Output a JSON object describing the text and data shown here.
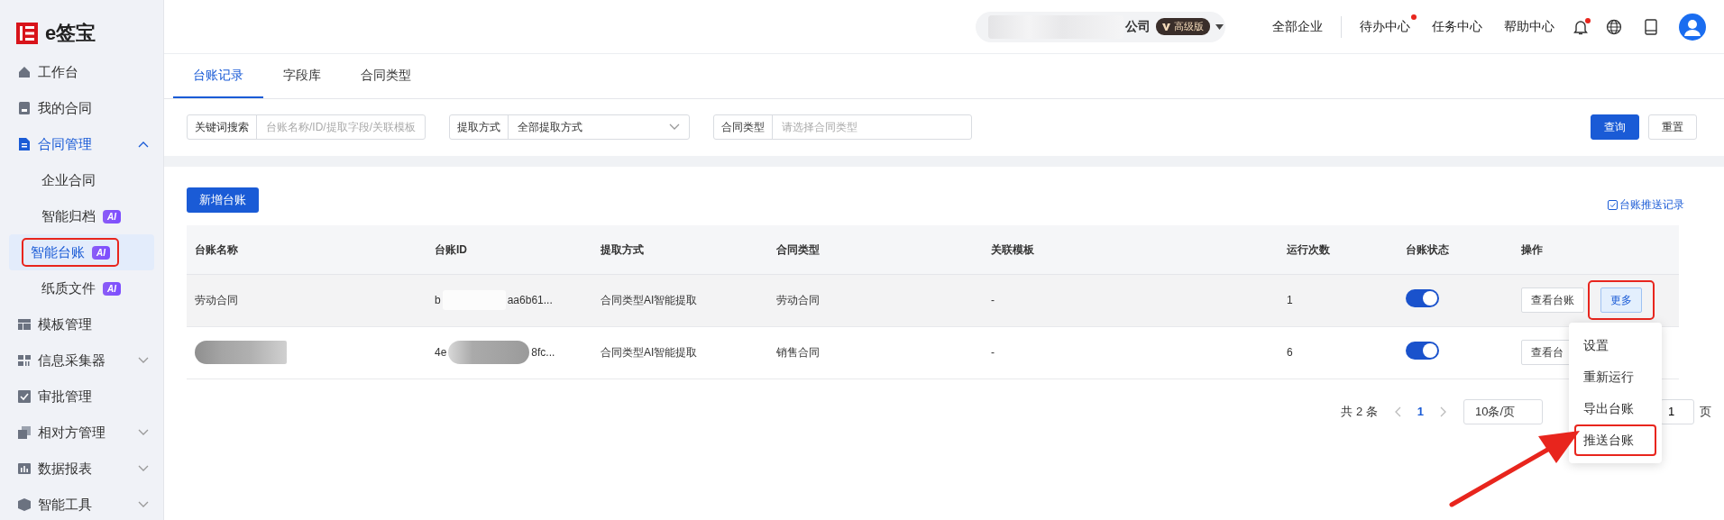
{
  "logo": {
    "text": "e签宝"
  },
  "sidebar": {
    "items": [
      {
        "label": "工作台",
        "selected": false
      },
      {
        "label": "我的合同",
        "selected": false
      },
      {
        "label": "合同管理",
        "selected": false,
        "active_group": true,
        "expanded": true,
        "children": [
          {
            "label": "企业合同",
            "selected": false,
            "annotated": false
          },
          {
            "label": "智能归档",
            "badge": "AI",
            "selected": false,
            "annotated": false
          },
          {
            "label": "智能台账",
            "badge": "AI",
            "selected": true,
            "annotated": true
          },
          {
            "label": "纸质文件",
            "badge": "AI",
            "selected": false,
            "annotated": false
          }
        ]
      },
      {
        "label": "模板管理",
        "selected": false
      },
      {
        "label": "信息采集器",
        "selected": false,
        "expanded": false
      },
      {
        "label": "审批管理",
        "selected": false
      },
      {
        "label": "相对方管理",
        "selected": false,
        "expanded": false
      },
      {
        "label": "数据报表",
        "selected": false,
        "expanded": false
      },
      {
        "label": "智能工具",
        "selected": false,
        "expanded": false
      }
    ]
  },
  "topbar": {
    "company": {
      "text": "公司",
      "badge": "高级版"
    },
    "links": [
      {
        "label": "全部企业",
        "dot": false
      },
      {
        "label": "待办中心",
        "dot": true
      },
      {
        "label": "任务中心",
        "dot": false
      },
      {
        "label": "帮助中心",
        "dot": false
      }
    ],
    "notification_dot": true
  },
  "tabs": [
    {
      "label": "台账记录",
      "selected": true
    },
    {
      "label": "字段库",
      "selected": false
    },
    {
      "label": "合同类型",
      "selected": false
    }
  ],
  "filters": [
    {
      "kind": "input",
      "label": "关键词搜索",
      "placeholder": "台账名称/ID/提取字段/关联模板"
    },
    {
      "kind": "select",
      "label": "提取方式",
      "value": "全部提取方式"
    },
    {
      "kind": "input",
      "label": "合同类型",
      "placeholder": "请选择合同类型"
    }
  ],
  "filter_buttons": [
    {
      "label": "查询",
      "kind": "primary"
    },
    {
      "label": "重置",
      "kind": "default"
    }
  ],
  "add_button": "新增台账",
  "push_record_link": "台账推送记录",
  "table": {
    "columns": [
      "台账名称",
      "台账ID",
      "提取方式",
      "合同类型",
      "关联模板",
      "运行次数",
      "台账状态",
      "操作"
    ],
    "rows": [
      {
        "hovered": true,
        "name": "劳动合同",
        "id": {
          "start": "b",
          "end": "aa6b61..."
        },
        "method": "合同类型AI智能提取",
        "type": "劳动合同",
        "template": "-",
        "runs": "1",
        "enabled": true,
        "actions": [
          {
            "label": "查看台账",
            "kind": "default",
            "annotated": false
          },
          {
            "label": "更多",
            "kind": "active",
            "annotated": true
          }
        ]
      },
      {
        "hovered": false,
        "id": {
          "start": "4e",
          "end": "8fc..."
        },
        "method": "合同类型AI智能提取",
        "type": "销售合同",
        "template": "-",
        "runs": "6",
        "enabled": true,
        "actions": [
          {
            "label": "查看台",
            "kind": "default",
            "annotated": false
          }
        ]
      }
    ]
  },
  "pagination": {
    "total": "共 2 条",
    "pages": [
      {
        "label": "1",
        "selected": true
      }
    ],
    "page_size": "10条/页",
    "goto": "1",
    "suffix": "页"
  },
  "menu": {
    "items": [
      {
        "label": "设置",
        "annotated": false
      },
      {
        "label": "重新运行",
        "annotated": false
      },
      {
        "label": "导出台账",
        "annotated": false
      },
      {
        "label": "推送台账",
        "annotated": true
      }
    ]
  }
}
